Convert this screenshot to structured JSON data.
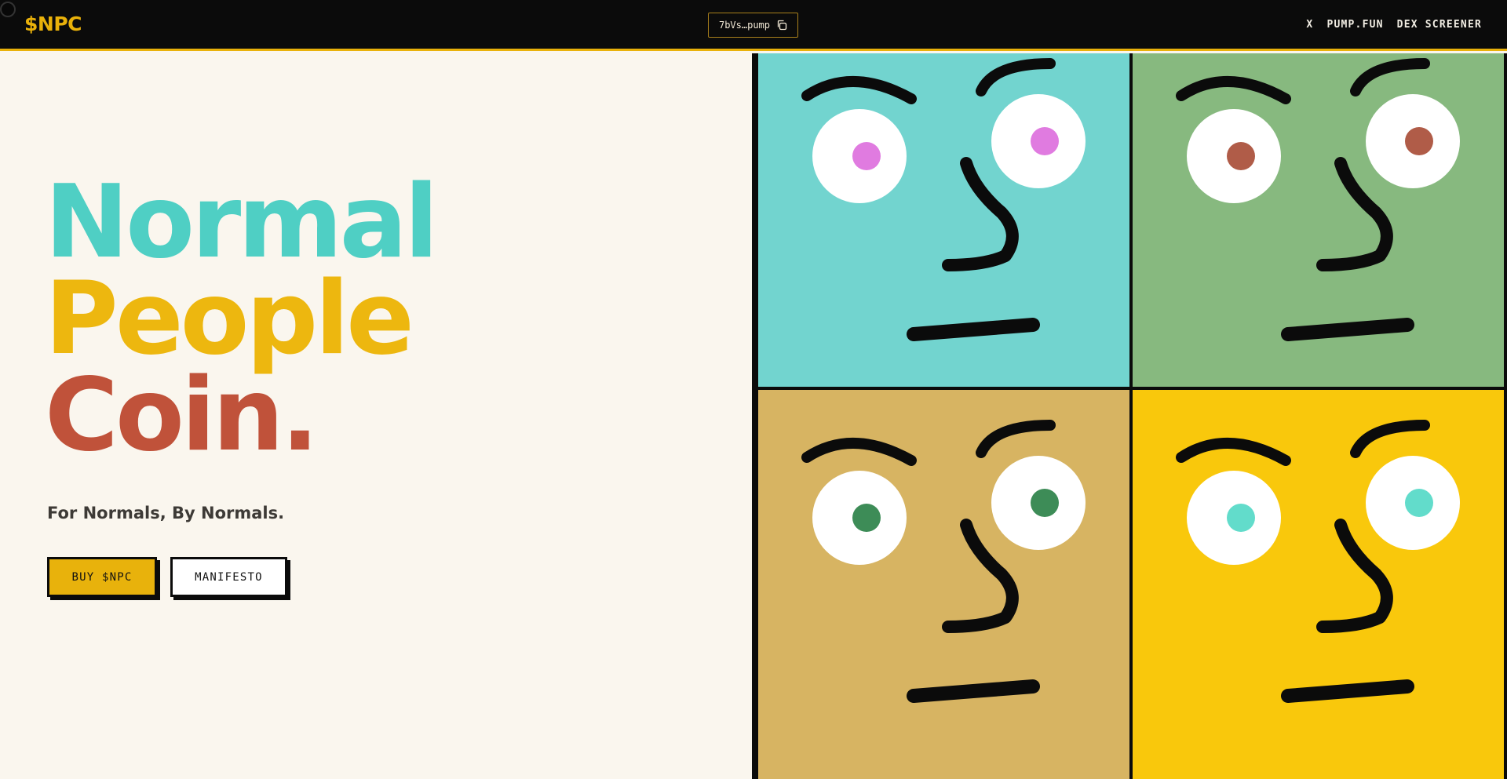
{
  "header": {
    "logo": "$NPC",
    "contract_address": "7bVs…pump",
    "nav": [
      "X",
      "PUMP.FUN",
      "DEX SCREENER"
    ]
  },
  "hero": {
    "line1": "Normal",
    "line2": "People",
    "line3": "Coin.",
    "tagline": "For Normals, By Normals.",
    "buy_label": "BUY $NPC",
    "manifesto_label": "MANIFESTO"
  },
  "tiles": [
    {
      "background": "#72d4cf",
      "pupil": "#e07be0"
    },
    {
      "background": "#87b97f",
      "pupil": "#b05c48"
    },
    {
      "background": "#d7b462",
      "pupil": "#3d8c57"
    },
    {
      "background": "#f9c80c",
      "pupil": "#62dccb"
    }
  ]
}
